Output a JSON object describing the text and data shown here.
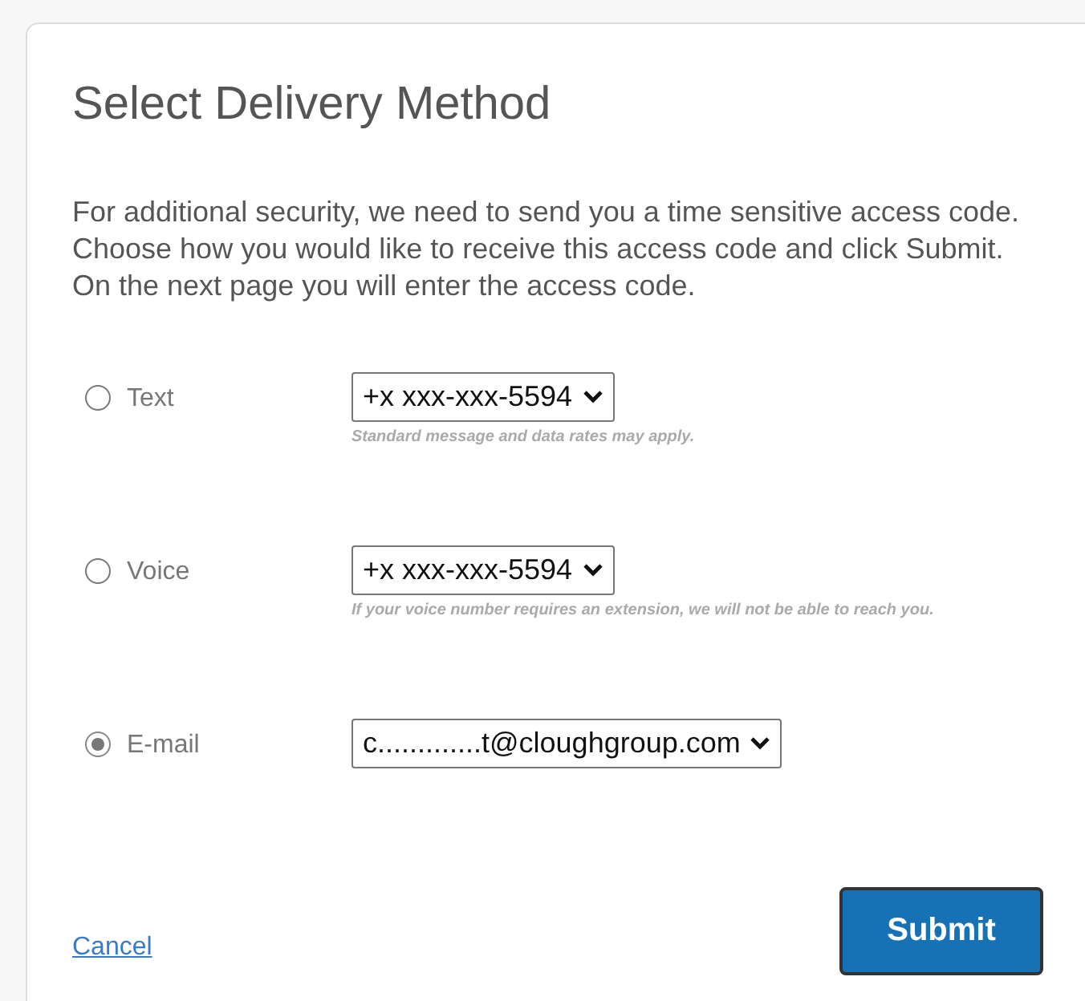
{
  "title": "Select Delivery Method",
  "intro": "For additional security, we need to send you a time sensitive access code. Choose how you would like to receive this access code and click Submit. On the next page you will enter the access code.",
  "options": [
    {
      "label": "Text",
      "selected": false,
      "value": "+x xxx-xxx-5594",
      "hint": "Standard message and data rates may apply."
    },
    {
      "label": "Voice",
      "selected": false,
      "value": "+x xxx-xxx-5594",
      "hint": "If your voice number requires an extension, we will not be able to reach you."
    },
    {
      "label": "E-mail",
      "selected": true,
      "value": "c.............t@cloughgroup.com"
    }
  ],
  "cancel": "Cancel",
  "submit": "Submit"
}
